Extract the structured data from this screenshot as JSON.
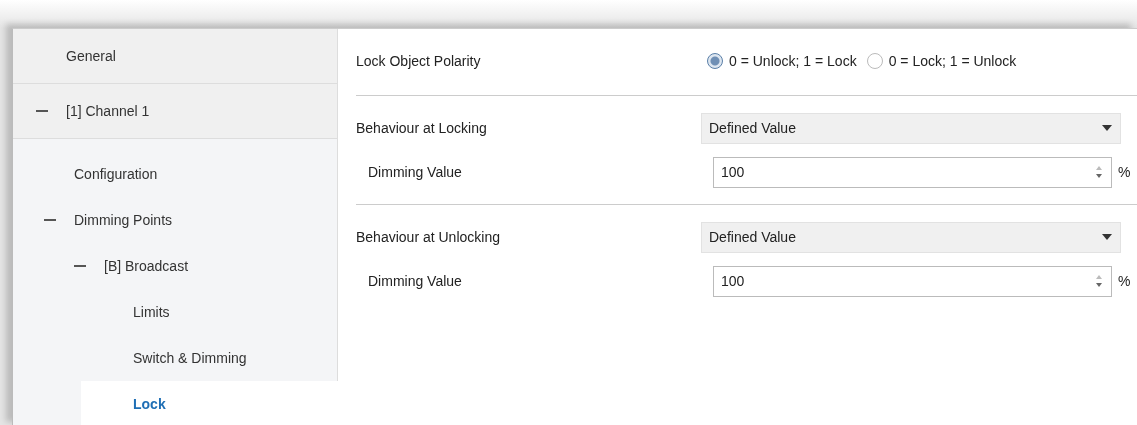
{
  "sidebar": {
    "items": [
      {
        "label": "General",
        "selected": false
      },
      {
        "label": "[1] Channel 1",
        "selected": false,
        "expanded": true,
        "children": [
          {
            "label": "Configuration",
            "selected": false
          },
          {
            "label": "Dimming Points",
            "selected": false,
            "expanded": true,
            "children": [
              {
                "label": "[B] Broadcast",
                "selected": false,
                "expanded": true,
                "children": [
                  {
                    "label": "Limits",
                    "selected": false
                  },
                  {
                    "label": "Switch & Dimming",
                    "selected": false
                  },
                  {
                    "label": "Lock",
                    "selected": true
                  }
                ]
              }
            ]
          }
        ]
      }
    ]
  },
  "sections": [
    {
      "rows": [
        {
          "kind": "radio",
          "label": "Lock Object Polarity",
          "options": [
            {
              "label": "0 = Unlock; 1 = Lock",
              "selected": true
            },
            {
              "label": "0 = Lock; 1 = Unlock",
              "selected": false
            }
          ]
        }
      ]
    },
    {
      "rows": [
        {
          "kind": "dropdown",
          "label": "Behaviour at Locking",
          "value": "Defined Value"
        },
        {
          "kind": "spin",
          "label": "Dimming Value",
          "value": "100",
          "unit": "%"
        }
      ]
    },
    {
      "rows": [
        {
          "kind": "dropdown",
          "label": "Behaviour at Unlocking",
          "value": "Defined Value"
        },
        {
          "kind": "spin",
          "label": "Dimming Value",
          "value": "100",
          "unit": "%"
        }
      ]
    }
  ]
}
